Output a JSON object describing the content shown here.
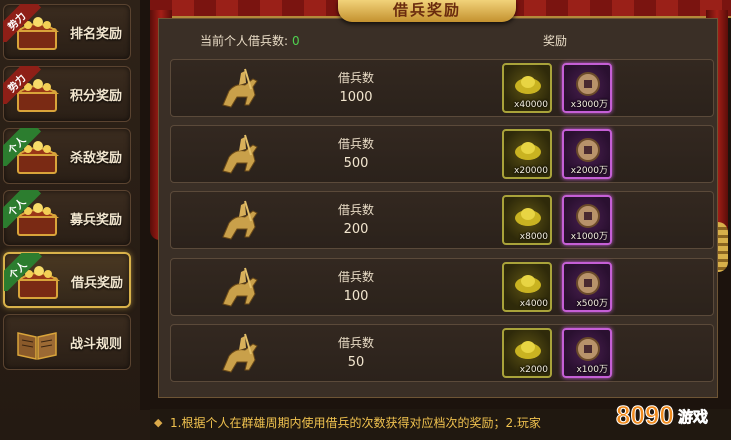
{
  "sidebar": {
    "items": [
      {
        "label": "排名奖励",
        "tag": "势力",
        "tag_color": "red",
        "active": false
      },
      {
        "label": "积分奖励",
        "tag": "势力",
        "tag_color": "red",
        "active": false
      },
      {
        "label": "杀敌奖励",
        "tag": "个人",
        "tag_color": "green",
        "active": false
      },
      {
        "label": "募兵奖励",
        "tag": "个人",
        "tag_color": "green",
        "active": false
      },
      {
        "label": "借兵奖励",
        "tag": "个人",
        "tag_color": "green",
        "active": true
      },
      {
        "label": "战斗规则",
        "tag": "",
        "tag_color": "",
        "active": false
      }
    ]
  },
  "panel": {
    "title": "借兵奖励",
    "count_label": "当前个人借兵数:",
    "count_value": "0",
    "reward_header": "奖励",
    "rows": [
      {
        "label": "借兵数",
        "value": "1000",
        "gold_qty": "x40000",
        "coin_qty": "x3000万"
      },
      {
        "label": "借兵数",
        "value": "500",
        "gold_qty": "x20000",
        "coin_qty": "x2000万"
      },
      {
        "label": "借兵数",
        "value": "200",
        "gold_qty": "x8000",
        "coin_qty": "x1000万"
      },
      {
        "label": "借兵数",
        "value": "100",
        "gold_qty": "x4000",
        "coin_qty": "x500万"
      },
      {
        "label": "借兵数",
        "value": "50",
        "gold_qty": "x2000",
        "coin_qty": "x100万"
      }
    ]
  },
  "footer": {
    "text": "1.根据个人在群雄周期内使用借兵的次数获得对应档次的奖励；2.玩家"
  },
  "watermark": {
    "text": "8090游戏"
  },
  "colors": {
    "accent_gold": "#d9b24a",
    "count_green": "#4fd14f",
    "footer_text": "#f0c24f",
    "tag_red": "#8e1f17",
    "tag_green": "#2c7d2f",
    "coin_frame": "#c55fd6"
  },
  "icons": {
    "row_icon": "horse-rider-icon",
    "reward_1": "gold-ingot-icon",
    "reward_2": "copper-coin-icon",
    "sidebar": "treasure-chest-icon",
    "rules": "book-icon"
  }
}
